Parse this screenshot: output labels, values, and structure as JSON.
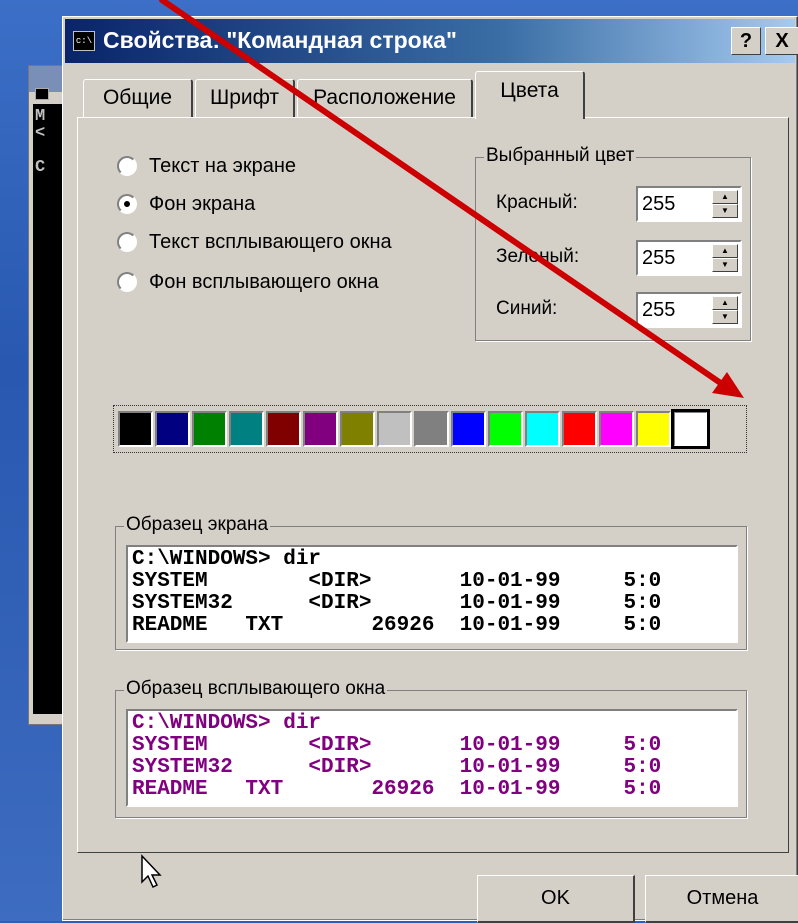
{
  "window": {
    "title": "Свойства: \"Командная строка\"",
    "help_button": "?",
    "close_button": "X"
  },
  "background_console": {
    "lines": "M\n<\n\nC"
  },
  "tabs": [
    {
      "label": "Общие"
    },
    {
      "label": "Шрифт"
    },
    {
      "label": "Расположение"
    },
    {
      "label": "Цвета",
      "active": true
    }
  ],
  "color_targets": [
    {
      "label": "Текст на экране",
      "checked": false
    },
    {
      "label": "Фон экрана",
      "checked": true
    },
    {
      "label": "Текст всплывающего окна",
      "checked": false
    },
    {
      "label": "Фон всплывающего окна",
      "checked": false
    }
  ],
  "selected_color": {
    "group_label": "Выбранный цвет",
    "red_label": "Красный:",
    "red_value": "255",
    "green_label": "Зеленый:",
    "green_value": "255",
    "blue_label": "Синий:",
    "blue_value": "255"
  },
  "palette": [
    "#000000",
    "#000080",
    "#008000",
    "#008080",
    "#800000",
    "#800080",
    "#808000",
    "#c0c0c0",
    "#808080",
    "#0000ff",
    "#00ff00",
    "#00ffff",
    "#ff0000",
    "#ff00ff",
    "#ffff00",
    "#ffffff"
  ],
  "palette_selected_index": 15,
  "screen_sample": {
    "label": "Образец экрана",
    "text": "C:\\WINDOWS> dir\nSYSTEM        <DIR>       10-01-99     5:0\nSYSTEM32      <DIR>       10-01-99     5:0\nREADME   TXT       26926  10-01-99     5:0"
  },
  "popup_sample": {
    "label": "Образец всплывающего окна",
    "text": "C:\\WINDOWS> dir\nSYSTEM        <DIR>       10-01-99     5:0\nSYSTEM32      <DIR>       10-01-99     5:0\nREADME   TXT       26926  10-01-99     5:0"
  },
  "buttons": {
    "ok": "OK",
    "cancel": "Отмена"
  },
  "colors": {
    "annotation_arrow": "#cc0000",
    "titlebar_start": "#0a246a",
    "dialog_face": "#d4d0c8",
    "popup_text": "#800080"
  }
}
